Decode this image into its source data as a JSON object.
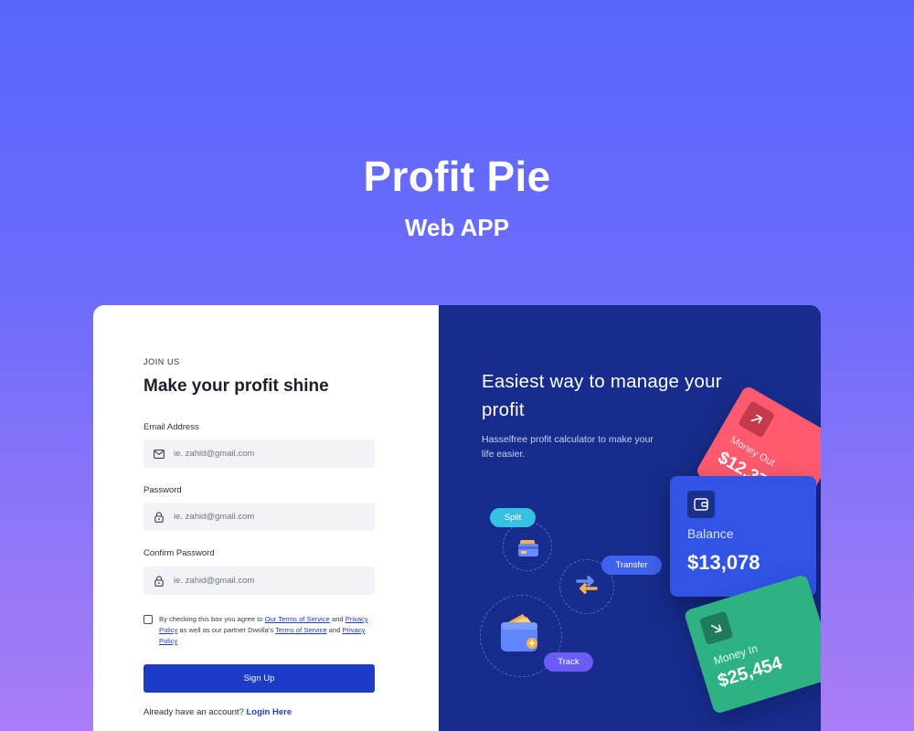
{
  "hero": {
    "title": "Profit Pie",
    "subtitle": "Web APP"
  },
  "form": {
    "eyebrow": "JOIN US",
    "title": "Make your profit shine",
    "email_label": "Email Address",
    "email_placeholder": "ie. zahid@gmail.com",
    "password_label": "Password",
    "password_placeholder": "ie. zahid@gmail.com",
    "confirm_label": "Confirm Password",
    "confirm_placeholder": "ie. zahid@gmail.com",
    "consent_part1": "By checking this box you agree to ",
    "consent_terms1": "Our Terms of Service",
    "consent_part2": " and ",
    "consent_privacy1": "Privacy Policy",
    "consent_part3": " as well as our partner Dwolla's ",
    "consent_terms2": "Terms of Service",
    "consent_part4": " and ",
    "consent_privacy2": "Privacy Policy",
    "signup_label": "Sign Up",
    "login_prompt": "Already have an account? ",
    "login_link": "Login Here"
  },
  "promo": {
    "title": "Easiest way to manage your profit",
    "description": "Hasselfree profit calculator to make your life easier.",
    "pills": {
      "split": "Split",
      "transfer": "Transfer",
      "track": "Track"
    },
    "cards": {
      "money_out_label": "Money Out",
      "money_out_amount": "$12,376",
      "balance_label": "Balance",
      "balance_amount": "$13,078",
      "money_in_label": "Money In",
      "money_in_amount": "$25,454"
    }
  },
  "colors": {
    "background_top": "#5865fb",
    "background_bottom": "#a97df5",
    "primary_button": "#1c3bc6",
    "promo_panel": "#172c8c",
    "card_money_out": "#ff5a6e",
    "card_balance": "#3153e6",
    "card_money_in": "#2fb281",
    "pill_split": "#35c2e0",
    "pill_transfer": "#3e63f0",
    "pill_track": "#6a5cf5"
  },
  "icons": [
    "mail-icon",
    "lock-icon",
    "wallet-icon",
    "arrow-up-right-icon",
    "arrow-down-right-icon",
    "credit-card-icon",
    "transfer-arrows-icon",
    "wallet-coin-icon"
  ]
}
